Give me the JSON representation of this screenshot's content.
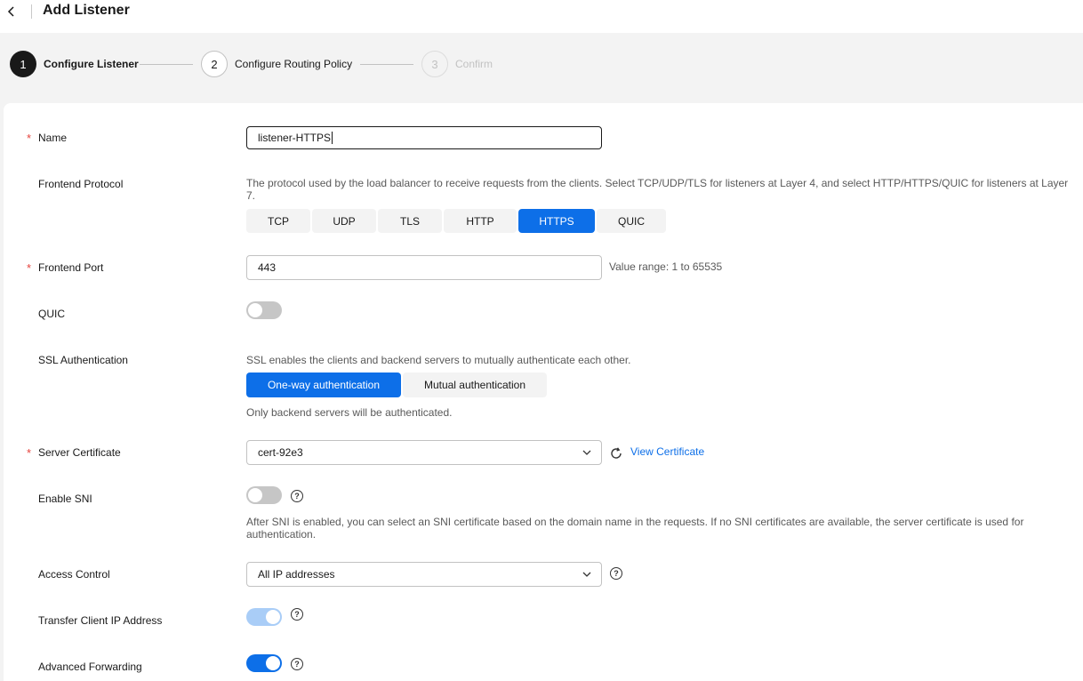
{
  "header": {
    "title": "Add Listener"
  },
  "steps": [
    {
      "num": "1",
      "label": "Configure Listener"
    },
    {
      "num": "2",
      "label": "Configure Routing Policy"
    },
    {
      "num": "3",
      "label": "Confirm"
    }
  ],
  "form": {
    "name": {
      "label": "Name",
      "value": "listener-HTTPS"
    },
    "frontend_protocol": {
      "label": "Frontend Protocol",
      "hint": "The protocol used by the load balancer to receive requests from the clients. Select TCP/UDP/TLS for listeners at Layer 4, and select HTTP/HTTPS/QUIC for listeners at Layer 7.",
      "options": [
        "TCP",
        "UDP",
        "TLS",
        "HTTP",
        "HTTPS",
        "QUIC"
      ],
      "selected": "HTTPS"
    },
    "frontend_port": {
      "label": "Frontend Port",
      "value": "443",
      "hint": "Value range: 1 to 65535"
    },
    "quic": {
      "label": "QUIC"
    },
    "ssl_auth": {
      "label": "SSL Authentication",
      "hint": "SSL enables the clients and backend servers to mutually authenticate each other.",
      "options": [
        "One-way authentication",
        "Mutual authentication"
      ],
      "selected": "One-way authentication",
      "note": "Only backend servers will be authenticated."
    },
    "server_cert": {
      "label": "Server Certificate",
      "value": "cert-92e3",
      "link": "View Certificate"
    },
    "enable_sni": {
      "label": "Enable SNI",
      "hint": "After SNI is enabled, you can select an SNI certificate based on the domain name in the requests. If no SNI certificates are available, the server certificate is used for authentication."
    },
    "access_control": {
      "label": "Access Control",
      "value": "All IP addresses"
    },
    "transfer_ip": {
      "label": "Transfer Client IP Address"
    },
    "advanced_forwarding": {
      "label": "Advanced Forwarding"
    }
  },
  "colors": {
    "primary": "#0d6fe8",
    "required": "#e6443e"
  }
}
